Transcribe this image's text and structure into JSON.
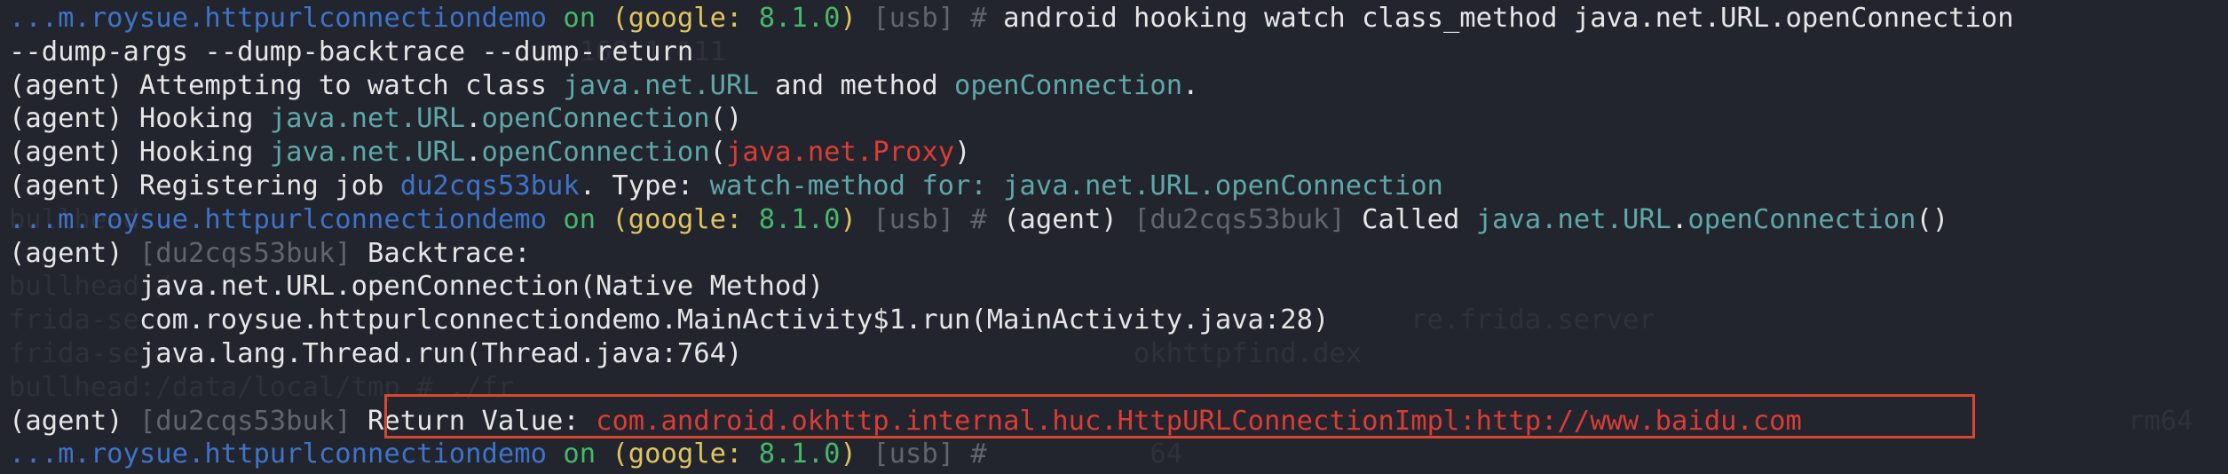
{
  "terminal": {
    "background_text": [
      "                                           ",
      "                                   168.1.111",
      "",
      "",
      "",
      "",
      "bullhead",
      "",
      "bullhead:/",
      "frida-se                                                                              re.frida.server",
      "frida-se                                                             okhttpfind.dex",
      "bullhead:/data/local/tmp # ./fr",
      "                                                                                                                                  rm64",
      "                                                                      64"
    ],
    "lines": [
      {
        "segments": [
          {
            "text": "...m.roysue.httpurlconnectiondemo",
            "color": "blue"
          },
          {
            "text": " on ",
            "color": "green"
          },
          {
            "text": "(google: ",
            "color": "yellow"
          },
          {
            "text": "8.1.0",
            "color": "green"
          },
          {
            "text": ")",
            "color": "yellow"
          },
          {
            "text": " [usb] # ",
            "color": "gray"
          },
          {
            "text": "android hooking watch class_method java.net.URL.openConnection",
            "color": "white"
          }
        ]
      },
      {
        "segments": [
          {
            "text": "--dump-args --dump-backtrace --dump-return",
            "color": "white"
          }
        ]
      },
      {
        "segments": [
          {
            "text": "(agent) Attempting to watch class ",
            "color": "white"
          },
          {
            "text": "java.net.URL",
            "color": "teal"
          },
          {
            "text": " and method ",
            "color": "white"
          },
          {
            "text": "openConnection",
            "color": "teal"
          },
          {
            "text": ".",
            "color": "white"
          }
        ]
      },
      {
        "segments": [
          {
            "text": "(agent) Hooking ",
            "color": "white"
          },
          {
            "text": "java.net.URL",
            "color": "teal"
          },
          {
            "text": ".",
            "color": "white"
          },
          {
            "text": "openConnection",
            "color": "teal"
          },
          {
            "text": "()",
            "color": "white"
          }
        ]
      },
      {
        "segments": [
          {
            "text": "(agent) Hooking ",
            "color": "white"
          },
          {
            "text": "java.net.URL",
            "color": "teal"
          },
          {
            "text": ".",
            "color": "white"
          },
          {
            "text": "openConnection",
            "color": "teal"
          },
          {
            "text": "(",
            "color": "white"
          },
          {
            "text": "java.net.Proxy",
            "color": "red"
          },
          {
            "text": ")",
            "color": "white"
          }
        ]
      },
      {
        "segments": [
          {
            "text": "(agent) Registering job ",
            "color": "white"
          },
          {
            "text": "du2cqs53buk",
            "color": "blue"
          },
          {
            "text": ". Type: ",
            "color": "white"
          },
          {
            "text": "watch-method for: java.net.URL.openConnection",
            "color": "teal"
          }
        ]
      },
      {
        "segments": [
          {
            "text": "...m.roysue.httpurlconnectiondemo",
            "color": "blue"
          },
          {
            "text": " on ",
            "color": "green"
          },
          {
            "text": "(google: ",
            "color": "yellow"
          },
          {
            "text": "8.1.0",
            "color": "green"
          },
          {
            "text": ")",
            "color": "yellow"
          },
          {
            "text": " [usb] # ",
            "color": "gray"
          },
          {
            "text": "(agent) ",
            "color": "white"
          },
          {
            "text": "[du2cqs53buk]",
            "color": "gray"
          },
          {
            "text": " Called ",
            "color": "white"
          },
          {
            "text": "java.net.URL",
            "color": "teal"
          },
          {
            "text": ".",
            "color": "white"
          },
          {
            "text": "openConnection",
            "color": "teal"
          },
          {
            "text": "()",
            "color": "white"
          }
        ]
      },
      {
        "segments": [
          {
            "text": "(agent) ",
            "color": "white"
          },
          {
            "text": "[du2cqs53buk]",
            "color": "gray"
          },
          {
            "text": " Backtrace:",
            "color": "white"
          }
        ]
      },
      {
        "segments": [
          {
            "text": "        java.net.URL.openConnection(Native Method)",
            "color": "white"
          }
        ]
      },
      {
        "segments": [
          {
            "text": "        com.roysue.httpurlconnectiondemo.MainActivity$1.run(MainActivity.java:28)",
            "color": "white"
          }
        ]
      },
      {
        "segments": [
          {
            "text": "        java.lang.Thread.run(Thread.java:764)",
            "color": "white"
          }
        ]
      },
      {
        "segments": [
          {
            "text": "",
            "color": "white"
          }
        ]
      },
      {
        "segments": [
          {
            "text": "(agent) ",
            "color": "white"
          },
          {
            "text": "[du2cqs53buk]",
            "color": "gray"
          },
          {
            "text": " Return Value: ",
            "color": "white"
          },
          {
            "text": "com.android.okhttp.internal.huc.HttpURLConnectionImpl:http://www.baidu.com",
            "color": "red"
          }
        ]
      },
      {
        "segments": [
          {
            "text": "...m.roysue.httpurlconnectiondemo",
            "color": "blue"
          },
          {
            "text": " on ",
            "color": "green"
          },
          {
            "text": "(google: ",
            "color": "yellow"
          },
          {
            "text": "8.1.0",
            "color": "green"
          },
          {
            "text": ")",
            "color": "yellow"
          },
          {
            "text": " [usb] # ",
            "color": "gray"
          }
        ]
      }
    ],
    "highlight_color": "#d8472e",
    "colors": {
      "background": "#23252e",
      "blue": "#3d73c8",
      "green": "#44b96a",
      "yellow": "#e0c45c",
      "gray": "#5f646d",
      "teal": "#5ea8a8",
      "red": "#dc3c34",
      "white": "#e6e6e6"
    }
  }
}
